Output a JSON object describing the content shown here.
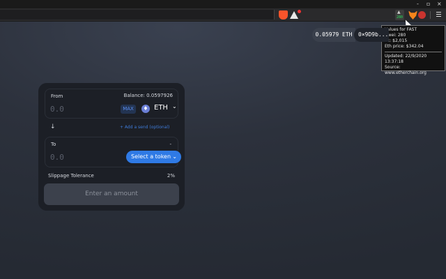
{
  "window": {
    "minimize": "-",
    "maximize": "▫",
    "close": "×"
  },
  "extensions": {
    "gas_badge": "280"
  },
  "tooltip": {
    "line1": "Values for FAST",
    "line2": "Gwei: 280",
    "line3": "Tx: $2,015",
    "line4": "Eth price: $342.04",
    "updated": "Updated: 22/9/2020 13:37:18",
    "source": "Source: www.etherchain.org"
  },
  "account": {
    "balance": "0.05979 ETH",
    "address": "0×9D9b..."
  },
  "swap": {
    "from_label": "From",
    "balance_text": "Balance: 0.0597926",
    "from_placeholder": "0.0",
    "max_label": "MAX",
    "from_token": "ETH",
    "eth_symbol": "♦",
    "arrow": "↓",
    "add_send": "+ Add a send (optional)",
    "to_label": "To",
    "to_dash": "-",
    "to_placeholder": "0.0",
    "select_token": "Select a token",
    "slippage_label": "Slippage Tolerance",
    "slippage_value": "2%",
    "submit": "Enter an amount"
  },
  "icons": {
    "chevron": "⌄"
  }
}
